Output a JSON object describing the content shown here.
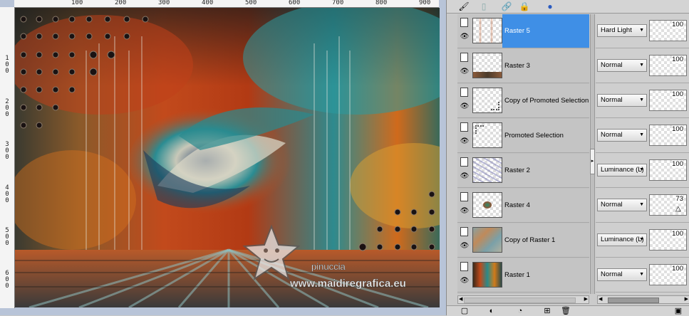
{
  "ruler": {
    "top_labels": [
      "100",
      "200",
      "300",
      "400",
      "500",
      "600",
      "700",
      "800",
      "900"
    ],
    "left_labels": [
      [
        "1",
        "0",
        "0"
      ],
      [
        "2",
        "0",
        "0"
      ],
      [
        "3",
        "0",
        "0"
      ],
      [
        "4",
        "0",
        "0"
      ],
      [
        "5",
        "0",
        "0"
      ],
      [
        "6",
        "0",
        "0"
      ]
    ]
  },
  "watermark": {
    "line1": "pinuccia",
    "line2": "www.maidiregrafica.eu"
  },
  "toolbar": {
    "icons": [
      "brush-icon",
      "document-icon",
      "link-icon",
      "lock-icon",
      "paint-blob-icon"
    ]
  },
  "layers": [
    {
      "name": "Raster 5",
      "blend": "Hard Light",
      "opacity": "100",
      "selected": true
    },
    {
      "name": "Raster 3",
      "blend": "Normal",
      "opacity": "100",
      "selected": false
    },
    {
      "name": "Copy of Promoted Selection",
      "blend": "Normal",
      "opacity": "100",
      "selected": false
    },
    {
      "name": "Promoted Selection",
      "blend": "Normal",
      "opacity": "100",
      "selected": false
    },
    {
      "name": "Raster 2",
      "blend": "Luminance (L)",
      "opacity": "100",
      "selected": false
    },
    {
      "name": "Raster 4",
      "blend": "Normal",
      "opacity": "73",
      "selected": false
    },
    {
      "name": "Copy of Raster 1",
      "blend": "Luminance (L)",
      "opacity": "100",
      "selected": false
    },
    {
      "name": "Raster 1",
      "blend": "Normal",
      "opacity": "100",
      "selected": false
    }
  ],
  "footer": {
    "icons": [
      "new-layer-icon",
      "mask-icon",
      "adjust-icon",
      "group-icon",
      "delete-icon",
      "properties-icon"
    ]
  },
  "colors": {
    "selected": "#3f8fe6",
    "panel": "#cbcbcb",
    "workspace": "#b8c4d8"
  }
}
